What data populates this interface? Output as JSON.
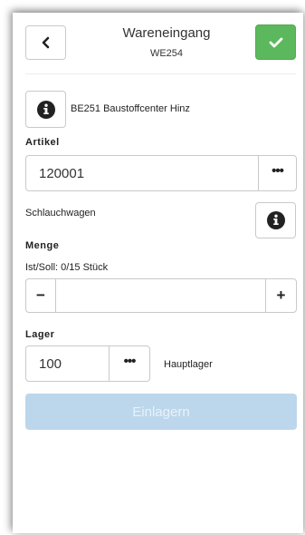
{
  "header": {
    "title": "Wareneingang",
    "subtitle": "WE254",
    "back_icon": "chevron-left-icon",
    "confirm_icon": "check-icon",
    "confirm_color": "#5cb85c"
  },
  "supplier": {
    "text": "BE251 Baustoffcenter Hinz",
    "icon": "info-icon"
  },
  "artikel": {
    "label": "Artikel",
    "value": "120001",
    "more_label": "•••",
    "description": "Schlauchwagen"
  },
  "menge": {
    "label": "Menge",
    "ist_soll": "Ist/Soll: 0/15 Stück",
    "minus_label": "−",
    "plus_label": "+",
    "value": ""
  },
  "lager": {
    "label": "Lager",
    "value": "100",
    "more_label": "•••",
    "name": "Hauptlager"
  },
  "submit": {
    "label": "Einlagern",
    "color": "#bcd7ec"
  }
}
